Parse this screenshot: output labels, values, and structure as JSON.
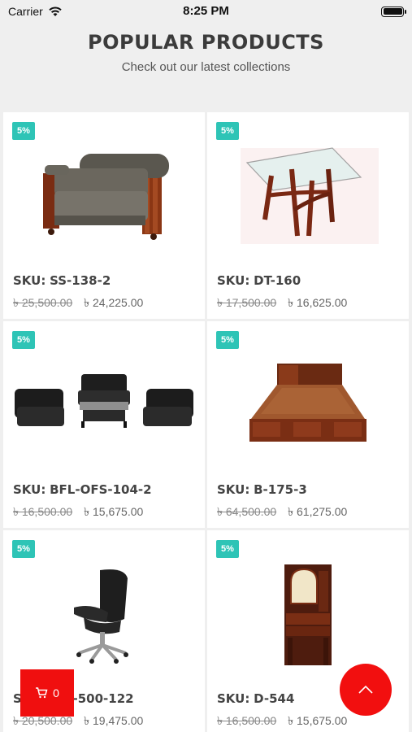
{
  "status_bar": {
    "carrier": "Carrier",
    "time": "8:25 PM"
  },
  "header": {
    "title": "POPULAR PRODUCTS",
    "subtitle": "Check out our latest collections"
  },
  "products": [
    {
      "badge": "5%",
      "sku_label": "SKU:",
      "sku": "SS-138-2",
      "old_price": "৳ 25,500.00",
      "price": "৳ 24,225.00",
      "image": "sofa"
    },
    {
      "badge": "5%",
      "sku_label": "SKU:",
      "sku": "DT-160",
      "old_price": "৳ 17,500.00",
      "price": "৳ 16,625.00",
      "image": "glass-table"
    },
    {
      "badge": "5%",
      "sku_label": "SKU:",
      "sku": "BFL-OFS-104-2",
      "old_price": "৳ 16,500.00",
      "price": "৳ 15,675.00",
      "image": "office-sofa-set"
    },
    {
      "badge": "5%",
      "sku_label": "SKU:",
      "sku": "B-175-3",
      "old_price": "৳ 64,500.00",
      "price": "৳ 61,275.00",
      "image": "bed"
    },
    {
      "badge": "5%",
      "sku_label": "SKU:",
      "sku": "-SC-500-122",
      "old_price": "৳ 20,500.00",
      "price": "৳ 19,475.00",
      "image": "office-chair"
    },
    {
      "badge": "5%",
      "sku_label": "SKU:",
      "sku": "D-544",
      "old_price": "৳ 16,500.00",
      "price": "৳ 15,675.00",
      "image": "dressing-table"
    }
  ],
  "cart": {
    "count": "0",
    "icon": "cart-icon"
  },
  "fab": {
    "icon": "chevron-up-icon"
  },
  "colors": {
    "badge": "#2ec4b6",
    "accent": "#f20f0f"
  }
}
